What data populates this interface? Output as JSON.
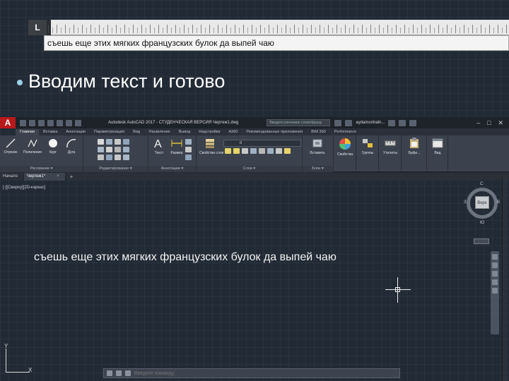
{
  "slide": {
    "editor_text": "съешь еще этих мягких французских булок да выпей чаю",
    "bullet_text": "Вводим текст и готово"
  },
  "ruler": {
    "corner_label": "L"
  },
  "app": {
    "logo": "A",
    "title": "Autodesk AutoCAD 2017 - СТУДЕНЧЕСКАЯ ВЕРСИЯ   Чертеж1.dwg",
    "search_placeholder": "Введите ключевое слово/фразу",
    "user": "aydamonhaln...",
    "window_controls": [
      "–",
      "□",
      "✕"
    ]
  },
  "ribbon": {
    "tabs": [
      "Главная",
      "Вставка",
      "Аннотации",
      "Параметризация",
      "Вид",
      "Управление",
      "Вывод",
      "Надстройки",
      "A360",
      "Рекомендованные приложения",
      "BIM 360",
      "Performance"
    ],
    "active_tab": 0,
    "panels": {
      "draw": {
        "title": "Рисование ▾",
        "tools": [
          "Отрезок",
          "Полилиния",
          "Круг",
          "Дуга"
        ]
      },
      "modify": {
        "title": "Редактирование ▾"
      },
      "annotation": {
        "title": "Аннотации ▾",
        "tools": [
          "Текст",
          "Размер"
        ]
      },
      "layers": {
        "title": "Слои ▾",
        "tool": "Свойства слоя",
        "combo": "0"
      },
      "block": {
        "title": "Блок ▾",
        "tool": "Вставить"
      },
      "properties": {
        "tool": "Свойства"
      },
      "groups": {
        "tool": "Группы"
      },
      "utilities": {
        "tool": "Утилиты"
      },
      "clipboard": {
        "tool": "Буфе..."
      },
      "view": {
        "tool": "Вид"
      }
    }
  },
  "file_tabs": [
    {
      "label": "Начало",
      "active": false
    },
    {
      "label": "Чертеж1*",
      "active": true
    }
  ],
  "file_tab_close": "×",
  "file_tab_add": "+",
  "viewport": {
    "label": "[-][Сверху][2D-каркас]",
    "canvas_text": "съешь еще этих мягких французских булок да выпей чаю",
    "viewcube": {
      "face": "Верх",
      "north": "С",
      "south": "Ю",
      "west": "З",
      "east": "В"
    },
    "ucs": {
      "x": "X",
      "y": "Y"
    }
  },
  "command_line": {
    "placeholder": "Введите команду"
  },
  "colors": {
    "background": "#222a36",
    "ribbon": "#3b424d",
    "bullet": "#9bd2e6",
    "autocad_red": "#b8191a"
  }
}
